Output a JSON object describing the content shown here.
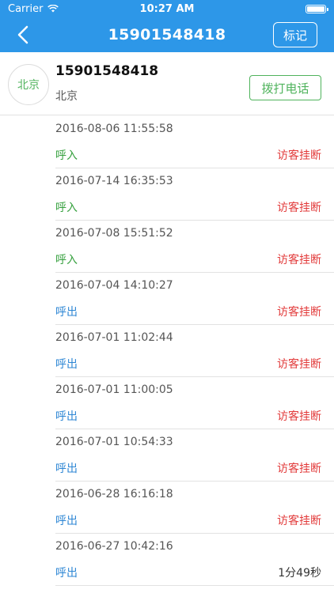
{
  "status_bar": {
    "carrier": "Carrier",
    "time": "10:27 AM",
    "wifi_icon": "wifi-icon",
    "battery_icon": "battery-icon"
  },
  "nav": {
    "back_icon": "back-chevron-icon",
    "title": "15901548418",
    "mark_button": "标记"
  },
  "contact": {
    "avatar_text": "北京",
    "phone": "15901548418",
    "city": "北京",
    "call_button": "拨打电话"
  },
  "colors": {
    "primary": "#2d97e8",
    "green": "#37a13f",
    "blue": "#2d86d4",
    "red": "#e23b3b"
  },
  "records": [
    {
      "time": "2016-08-06 11:55:58",
      "direction": "呼入",
      "dir_type": "in",
      "result": "访客挂断",
      "result_type": "red"
    },
    {
      "time": "2016-07-14 16:35:53",
      "direction": "呼入",
      "dir_type": "in",
      "result": "访客挂断",
      "result_type": "red"
    },
    {
      "time": "2016-07-08 15:51:52",
      "direction": "呼入",
      "dir_type": "in",
      "result": "访客挂断",
      "result_type": "red"
    },
    {
      "time": "2016-07-04 14:10:27",
      "direction": "呼出",
      "dir_type": "out",
      "result": "访客挂断",
      "result_type": "red"
    },
    {
      "time": "2016-07-01 11:02:44",
      "direction": "呼出",
      "dir_type": "out",
      "result": "访客挂断",
      "result_type": "red"
    },
    {
      "time": "2016-07-01 11:00:05",
      "direction": "呼出",
      "dir_type": "out",
      "result": "访客挂断",
      "result_type": "red"
    },
    {
      "time": "2016-07-01 10:54:33",
      "direction": "呼出",
      "dir_type": "out",
      "result": "访客挂断",
      "result_type": "red"
    },
    {
      "time": "2016-06-28 16:16:18",
      "direction": "呼出",
      "dir_type": "out",
      "result": "访客挂断",
      "result_type": "red"
    },
    {
      "time": "2016-06-27 10:42:16",
      "direction": "呼出",
      "dir_type": "out",
      "result": "1分49秒",
      "result_type": "dark"
    }
  ]
}
